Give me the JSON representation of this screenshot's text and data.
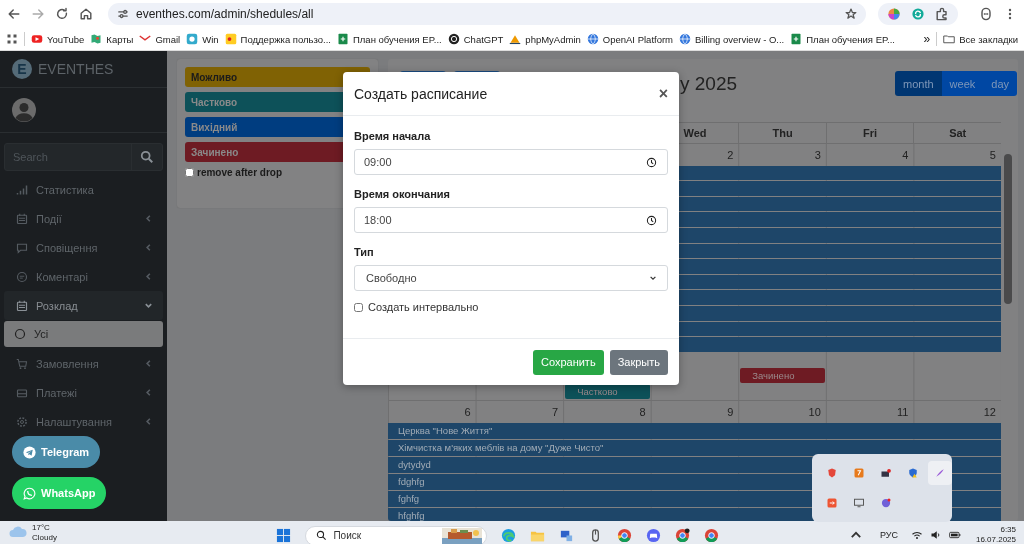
{
  "browser": {
    "address": "eventhes.com/admin/shedules/all",
    "bookmarks": [
      {
        "label": "YouTube"
      },
      {
        "label": "Карты"
      },
      {
        "label": "Gmail"
      },
      {
        "label": "Win"
      },
      {
        "label": "Поддержка пользо..."
      },
      {
        "label": "План обучения EP..."
      },
      {
        "label": "ChatGPT"
      },
      {
        "label": "phpMyAdmin"
      },
      {
        "label": "OpenAI Platform"
      },
      {
        "label": "Billing overview - O..."
      },
      {
        "label": "План обучения EP..."
      }
    ],
    "more": "»",
    "all_bookmarks": "Все закладки"
  },
  "sidebar": {
    "logo_letter": "E",
    "brand": "EVENTHES",
    "search": {
      "placeholder": "Search"
    },
    "items": [
      {
        "label": "Статистика",
        "kind": "link",
        "expanded": false
      },
      {
        "label": "Події",
        "kind": "menu",
        "expanded": false
      },
      {
        "label": "Сповіщення",
        "kind": "menu",
        "expanded": false
      },
      {
        "label": "Коментарі",
        "kind": "menu",
        "expanded": false
      },
      {
        "label": "Розклад",
        "kind": "menu",
        "expanded": true,
        "children": [
          {
            "label": "Усі",
            "selected": true
          }
        ]
      },
      {
        "label": "Замовлення",
        "kind": "menu",
        "expanded": false
      },
      {
        "label": "Платежі",
        "kind": "menu",
        "expanded": false
      },
      {
        "label": "Налаштування",
        "kind": "menu",
        "expanded": false
      }
    ]
  },
  "legend": {
    "items": [
      {
        "label": "Можливо",
        "color": "#806204"
      },
      {
        "label": "Частково",
        "color": "#0d5159"
      },
      {
        "label": "Вихідний",
        "color": "#003d80"
      },
      {
        "label": "Зачинено",
        "color": "#6e1b23"
      }
    ],
    "remove_after_drop": {
      "label": "remove after drop",
      "checked": false
    }
  },
  "calendar": {
    "title": "y 2025",
    "views": [
      {
        "label": "month",
        "selected": true
      },
      {
        "label": "week",
        "selected": false
      },
      {
        "label": "day",
        "selected": false
      }
    ],
    "weekdays": [
      {
        "label": "Wed"
      },
      {
        "label": "Thu"
      },
      {
        "label": "Fri"
      },
      {
        "label": "Sat"
      }
    ],
    "weeks": [
      {
        "days": [
          {
            "number": "2"
          },
          {
            "number": "3"
          },
          {
            "number": "4"
          },
          {
            "number": "5"
          }
        ],
        "bars": [
          {
            "color": "#1e4669"
          },
          {
            "color": "#1e4669"
          },
          {
            "color": "#1e4669"
          },
          {
            "color": "#1e4669"
          },
          {
            "color": "#1e4669"
          },
          {
            "color": "#1e4669"
          },
          {
            "color": "#1e4669"
          },
          {
            "color": "#1e4669"
          },
          {
            "color": "#1e4669"
          },
          {
            "color": "#1e4669"
          },
          {
            "color": "#1e4669"
          },
          {
            "color": "#1e4669"
          }
        ],
        "event_rows": [
          {
            "cells": [
              {
                "kind": "empty"
              },
              {
                "kind": "empty"
              },
              {
                "kind": "empty"
              },
              {
                "kind": "empty"
              },
              {
                "kind": "event",
                "title": "Зачинено",
                "color": "#6e1b23"
              },
              {
                "kind": "empty"
              },
              {
                "kind": "empty"
              }
            ]
          },
          {
            "cells": [
              {
                "kind": "empty"
              },
              {
                "kind": "empty"
              },
              {
                "kind": "event",
                "title": "Частково",
                "color": "#0d5159"
              },
              {
                "kind": "empty"
              },
              {
                "kind": "empty"
              },
              {
                "kind": "empty"
              },
              {
                "kind": "empty"
              }
            ]
          }
        ]
      },
      {
        "days": [
          {
            "number": "6"
          },
          {
            "number": "7"
          },
          {
            "number": "8"
          },
          {
            "number": "9"
          },
          {
            "number": "10"
          },
          {
            "number": "11"
          },
          {
            "number": "12"
          }
        ],
        "bars": [
          {
            "title": "Церква \"Нове Життя\"",
            "color": "#1e4669"
          },
          {
            "title": "Хімчистка м'яких меблів на дому \"Дуже Чисто\"",
            "color": "#1e4669"
          },
          {
            "title": "dytydyd",
            "color": "#1e4669"
          },
          {
            "title": "fdghfg",
            "color": "#1e4669"
          },
          {
            "title": "fghfg",
            "color": "#1e4669"
          },
          {
            "title": "hfghfg",
            "color": "#1e4669"
          }
        ]
      }
    ]
  },
  "modal": {
    "title": "Создать расписание",
    "close": "×",
    "start": {
      "label": "Время начала",
      "value": "09:00"
    },
    "end": {
      "label": "Время окончания",
      "value": "18:00"
    },
    "type": {
      "label": "Тип",
      "value": "Свободно"
    },
    "interval": {
      "label": "Создать интервально",
      "checked": false
    },
    "buttons": [
      {
        "label": "Сохранить",
        "kind": "primary"
      },
      {
        "label": "Закрыть",
        "kind": "secondary"
      }
    ]
  },
  "chat_buttons": [
    {
      "label": "Telegram",
      "kind": "telegram"
    },
    {
      "label": "WhatsApp",
      "kind": "whatsapp"
    }
  ],
  "taskbar": {
    "temperature": "17°C",
    "weather": "Cloudy",
    "search_placeholder": "Поиск",
    "language": "РУС",
    "time": "6:35",
    "date": "16.07.2025"
  }
}
